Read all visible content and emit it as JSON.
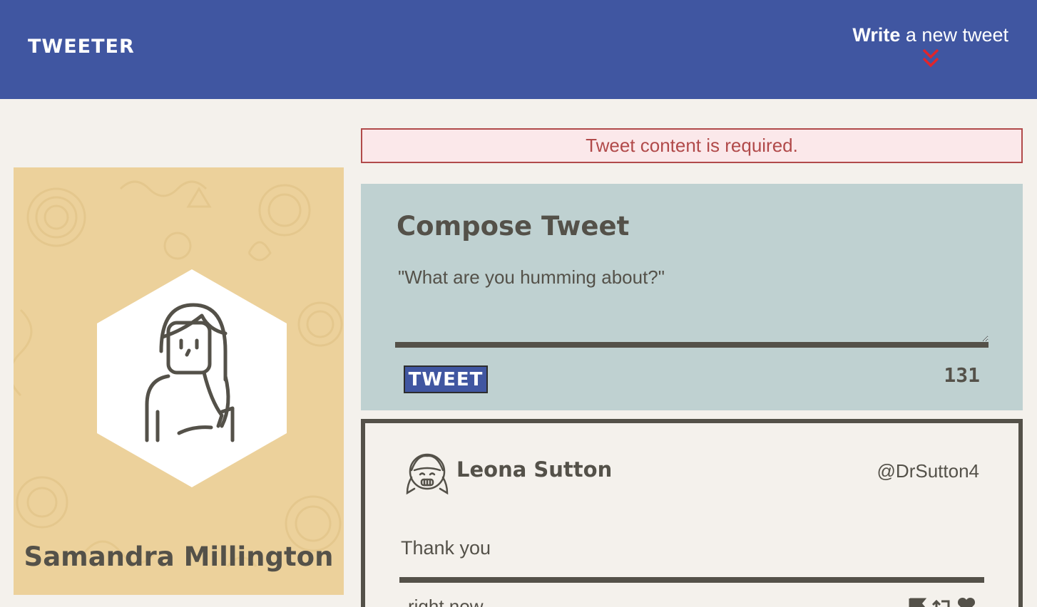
{
  "nav": {
    "brand": "TWEETER",
    "write_bold": "Write",
    "write_rest": " a new tweet",
    "toggle_icon": "double-chevron-down-icon"
  },
  "profile": {
    "name": "Samandra Millington",
    "avatar_icon": "woman-avatar-icon"
  },
  "error": {
    "message": "Tweet content is required."
  },
  "compose": {
    "title": "Compose Tweet",
    "placeholder": "\"What are you humming about?\"",
    "value": "",
    "button_label": "TWEET",
    "counter": "131"
  },
  "tweets": [
    {
      "name": "Leona Sutton",
      "handle": "@DrSutton4",
      "content": "Thank you",
      "time": "right now",
      "avatar_icon": "smiling-girl-avatar-icon",
      "actions": [
        "flag-icon",
        "retweet-icon",
        "heart-icon"
      ]
    }
  ],
  "colors": {
    "nav_bg": "#4056a1",
    "page_bg": "#f4f1ec",
    "profile_bg": "#ecd19b",
    "compose_bg": "#bfd1d1",
    "text": "#545149",
    "error": "#b14a4a",
    "accent_red": "#e0252b"
  }
}
